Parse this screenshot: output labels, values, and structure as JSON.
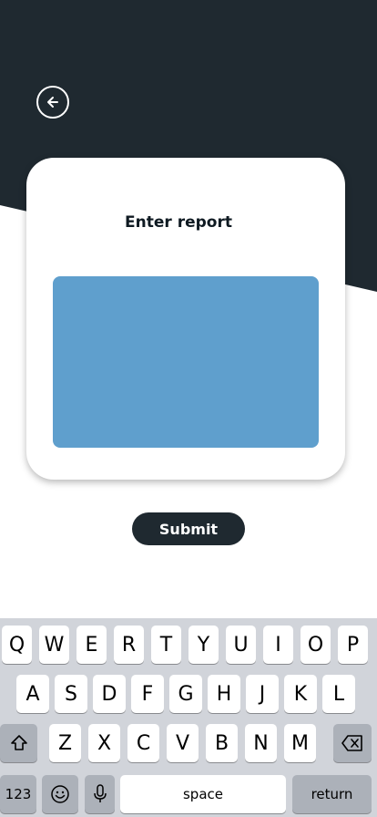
{
  "colors": {
    "header_dark": "#1f2930",
    "input_blue": "#5f9fcd",
    "submit_bg": "#1f2930",
    "keyboard_bg": "#d1d4da"
  },
  "header": {
    "back_icon": "arrow-left-circle-icon"
  },
  "card": {
    "title": "Enter report",
    "input_value": ""
  },
  "submit": {
    "label": "Submit"
  },
  "keyboard": {
    "row1": [
      "Q",
      "W",
      "E",
      "R",
      "T",
      "Y",
      "U",
      "I",
      "O",
      "P"
    ],
    "row2": [
      "A",
      "S",
      "D",
      "F",
      "G",
      "H",
      "J",
      "K",
      "L"
    ],
    "row3": [
      "Z",
      "X",
      "C",
      "V",
      "B",
      "N",
      "M"
    ],
    "numbers_label": "123",
    "space_label": "space",
    "return_label": "return",
    "shift_icon": "shift-icon",
    "delete_icon": "delete-icon",
    "emoji_icon": "emoji-icon",
    "mic_icon": "microphone-icon"
  }
}
